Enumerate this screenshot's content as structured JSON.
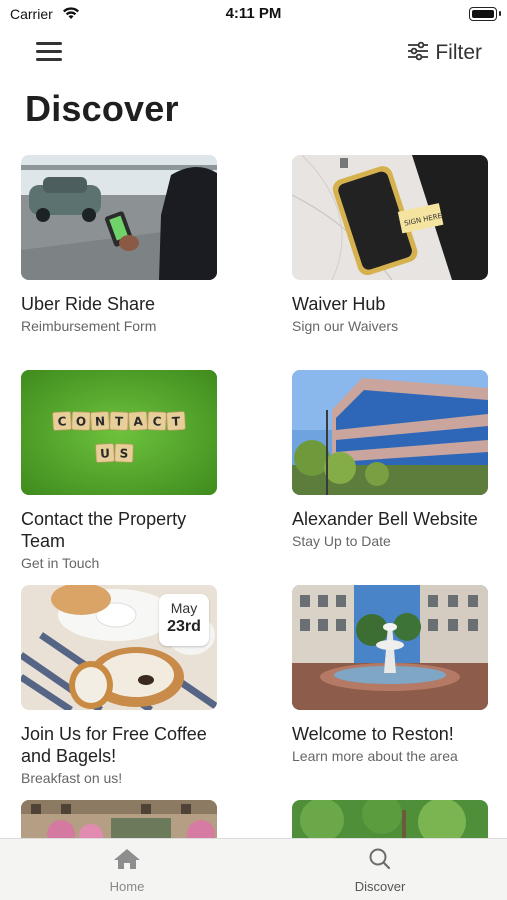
{
  "status": {
    "carrier": "Carrier",
    "time": "4:11 PM"
  },
  "header": {
    "filter_label": "Filter",
    "title": "Discover"
  },
  "cards": [
    {
      "title": "Uber Ride Share",
      "subtitle": "Reimbursement Form"
    },
    {
      "title": "Waiver Hub",
      "subtitle": "Sign our Waivers"
    },
    {
      "title": "Contact the Property Team",
      "subtitle": "Get in Touch"
    },
    {
      "title": "Alexander Bell Website",
      "subtitle": "Stay Up to Date"
    },
    {
      "title": "Join Us for Free Coffee and Bagels!",
      "subtitle": "Breakfast on us!",
      "badge_month": "May",
      "badge_day": "23rd"
    },
    {
      "title": "Welcome to Reston!",
      "subtitle": "Learn more about the area"
    }
  ],
  "images": {
    "contact_tiles_row1": [
      "C",
      "O",
      "N",
      "T",
      "A",
      "C",
      "T"
    ],
    "contact_tiles_row2": [
      "U",
      "S"
    ],
    "sign_text": "SIGN HERE"
  },
  "tabs": [
    {
      "label": "Home",
      "icon": "home-icon",
      "active": false
    },
    {
      "label": "Discover",
      "icon": "search-icon",
      "active": true
    }
  ],
  "colors": {
    "title": "#1f1f1f",
    "subtitle": "#666666",
    "tab_bar": "#f4f5f2"
  }
}
